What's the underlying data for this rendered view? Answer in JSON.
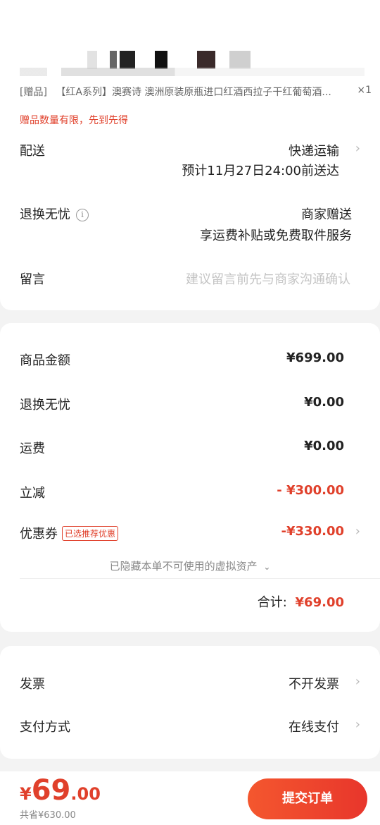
{
  "order": {
    "gift_item": {
      "tag": "[赠品]",
      "title": "【红A系列】澳赛诗 澳洲原装原瓶进口红酒西拉子干红葡萄酒...",
      "qty": "×1"
    },
    "gift_note": "赠品数量有限，先到先得",
    "delivery": {
      "label": "配送",
      "method": "快递运输",
      "eta": "预计11月27日24:00前送达"
    },
    "return_policy": {
      "label": "退换无忧",
      "info_icon": "i",
      "value": "商家赠送",
      "detail": "享运费补贴或免费取件服务"
    },
    "message": {
      "label": "留言",
      "placeholder": "建议留言前先与商家沟通确认"
    }
  },
  "summary": {
    "goods_label": "商品金额",
    "goods_value": "¥699.00",
    "return_label": "退换无忧",
    "return_value": "¥0.00",
    "shipping_label": "运费",
    "shipping_value": "¥0.00",
    "discount_label": "立减",
    "discount_value": "- ¥300.00",
    "coupon_label": "优惠券",
    "coupon_tag": "已选推荐优惠",
    "coupon_value": "-¥330.00",
    "hidden_note": "已隐藏本单不可使用的虚拟资产",
    "total_label": "合计:",
    "total_value": "¥69.00"
  },
  "invoice": {
    "label": "发票",
    "value": "不开发票"
  },
  "payment": {
    "label": "支付方式",
    "value": "在线支付"
  },
  "footer": {
    "price_symbol": "¥",
    "price_int": "69",
    "price_dec": ".00",
    "saved": "共省¥630.00",
    "submit_label": "提交订单"
  },
  "icons": {
    "chevron": "chevron-right-icon",
    "info": "info-icon",
    "chevron_down": "chevron-down-icon"
  },
  "colors": {
    "accent": "#e0402b",
    "placeholder": "#c4c4c4",
    "background": "#f3f3f3"
  }
}
